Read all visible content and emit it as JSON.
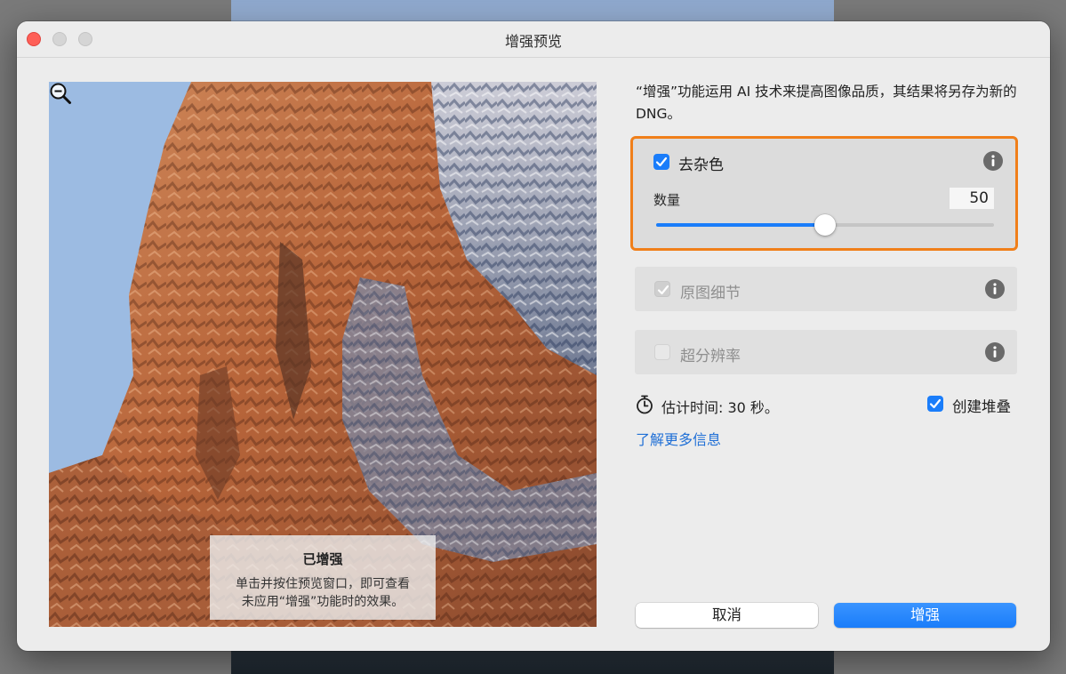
{
  "window": {
    "title": "增强预览"
  },
  "preview": {
    "overlay_title": "已增强",
    "overlay_text_line1": "单击并按住预览窗口，即可查看",
    "overlay_text_line2": "未应用“增强”功能时的效果。"
  },
  "panel": {
    "description": "“增强”功能运用 AI 技术来提高图像品质，其结果将另存为新的 DNG。",
    "denoise": {
      "label": "去杂色",
      "checked": true,
      "amount_label": "数量",
      "amount_value": "50",
      "amount_fraction": 0.5
    },
    "raw_details": {
      "label": "原图细节",
      "checked": true,
      "enabled": false
    },
    "super_resolution": {
      "label": "超分辨率",
      "checked": false,
      "enabled": false
    },
    "estimated_time": "估计时间: 30 秒。",
    "create_stack": {
      "label": "创建堆叠",
      "checked": true
    },
    "learn_more": "了解更多信息"
  },
  "buttons": {
    "cancel": "取消",
    "enhance": "增强"
  },
  "colors": {
    "accent": "#1a7dfa",
    "highlight_border": "#f07f1a",
    "link": "#1f6fd6",
    "close_button": "#fe5f57"
  },
  "icons": {
    "info": "info-icon",
    "zoom_out": "zoom-out-icon",
    "timer": "stopwatch-icon"
  }
}
